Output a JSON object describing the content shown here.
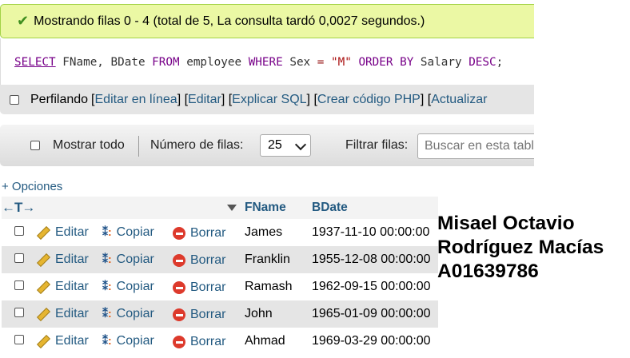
{
  "status": {
    "message": "Mostrando filas 0 - 4 (total de 5, La consulta tardó 0,0027 segundos.)"
  },
  "sql": {
    "select": "SELECT",
    "cols": " FName, BDate ",
    "from": "FROM",
    "table": " employee ",
    "where": "WHERE",
    "field": " Sex ",
    "op": "=",
    "value": " \"M\" ",
    "orderby": "ORDER BY",
    "orderfield": " Salary ",
    "desc": "DESC",
    "end": ";"
  },
  "profile": {
    "label": "Perfilando",
    "links": [
      "Editar en línea",
      "Editar",
      "Explicar SQL",
      "Crear código PHP",
      "Actualizar"
    ]
  },
  "nav": {
    "show_all": "Mostrar todo",
    "rows_label": "Número de filas:",
    "rows_value": "25",
    "filter_label": "Filtrar filas:",
    "filter_placeholder": "Buscar en esta tabla"
  },
  "options_link": "+ Opciones",
  "table": {
    "arrows": "←T→",
    "columns": [
      "FName",
      "BDate"
    ],
    "actions": {
      "edit": "Editar",
      "copy": "Copiar",
      "delete": "Borrar"
    },
    "rows": [
      {
        "fname": "James",
        "bdate": "1937-11-10 00:00:00"
      },
      {
        "fname": "Franklin",
        "bdate": "1955-12-08 00:00:00"
      },
      {
        "fname": "Ramash",
        "bdate": "1962-09-15 00:00:00"
      },
      {
        "fname": "John",
        "bdate": "1965-01-09 00:00:00"
      },
      {
        "fname": "Ahmad",
        "bdate": "1969-03-29 00:00:00"
      }
    ]
  },
  "author": {
    "line1": "Misael Octavio",
    "line2": "Rodríguez Macías",
    "line3": "A01639786"
  },
  "colors": {
    "success_bg": "#ebf8a4",
    "link": "#235a81",
    "delete": "#dd3a2c"
  }
}
